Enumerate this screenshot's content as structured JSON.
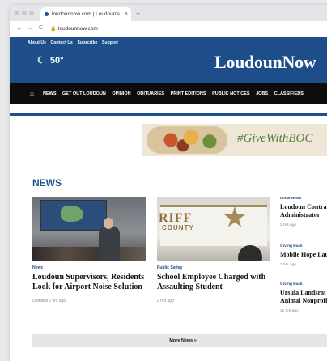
{
  "browser": {
    "tab_title": "loudounnow.com | Loudoun's",
    "tab_close": "×",
    "new_tab": "+",
    "url": "loudounnow.com",
    "back": "←",
    "forward": "→",
    "reload": "C"
  },
  "header": {
    "top_links": [
      "About Us",
      "Contact Us",
      "Subscribe",
      "Support"
    ],
    "weather_temp": "50°",
    "logo": "LoudounNow"
  },
  "nav": {
    "items": [
      "NEWS",
      "GET OUT LOUDOUN",
      "OPINION",
      "OBITUARIES",
      "PRINT EDITIONS",
      "PUBLIC NOTICES",
      "JOBS",
      "CLASSIFIEDS"
    ]
  },
  "ad": {
    "tagline": "#GiveWithBOC"
  },
  "section": {
    "title": "NEWS"
  },
  "stories": [
    {
      "category": "News",
      "headline": "Loudoun Supervisors, Residents Look for Airport Noise Solution",
      "meta": "Updated 2 hrs ago"
    },
    {
      "category": "Public Saftey",
      "headline": "School Employee Charged with Assaulting Student",
      "meta": "2 hrs ago"
    }
  ],
  "sidebar": [
    {
      "category": "Local News",
      "headline_lines": [
        "Loudoun Contra",
        "Administrator"
      ],
      "meta": "2 hrs ago"
    },
    {
      "category": "Giving Back",
      "headline_lines": [
        "Mobile Hope Lau"
      ],
      "meta": "3 hrs ago"
    },
    {
      "category": "Giving Back",
      "headline_lines": [
        "Ursula Landsrat",
        "Animal Nonprofi"
      ],
      "meta": "21 hrs ago"
    }
  ],
  "more_button": "More News »"
}
